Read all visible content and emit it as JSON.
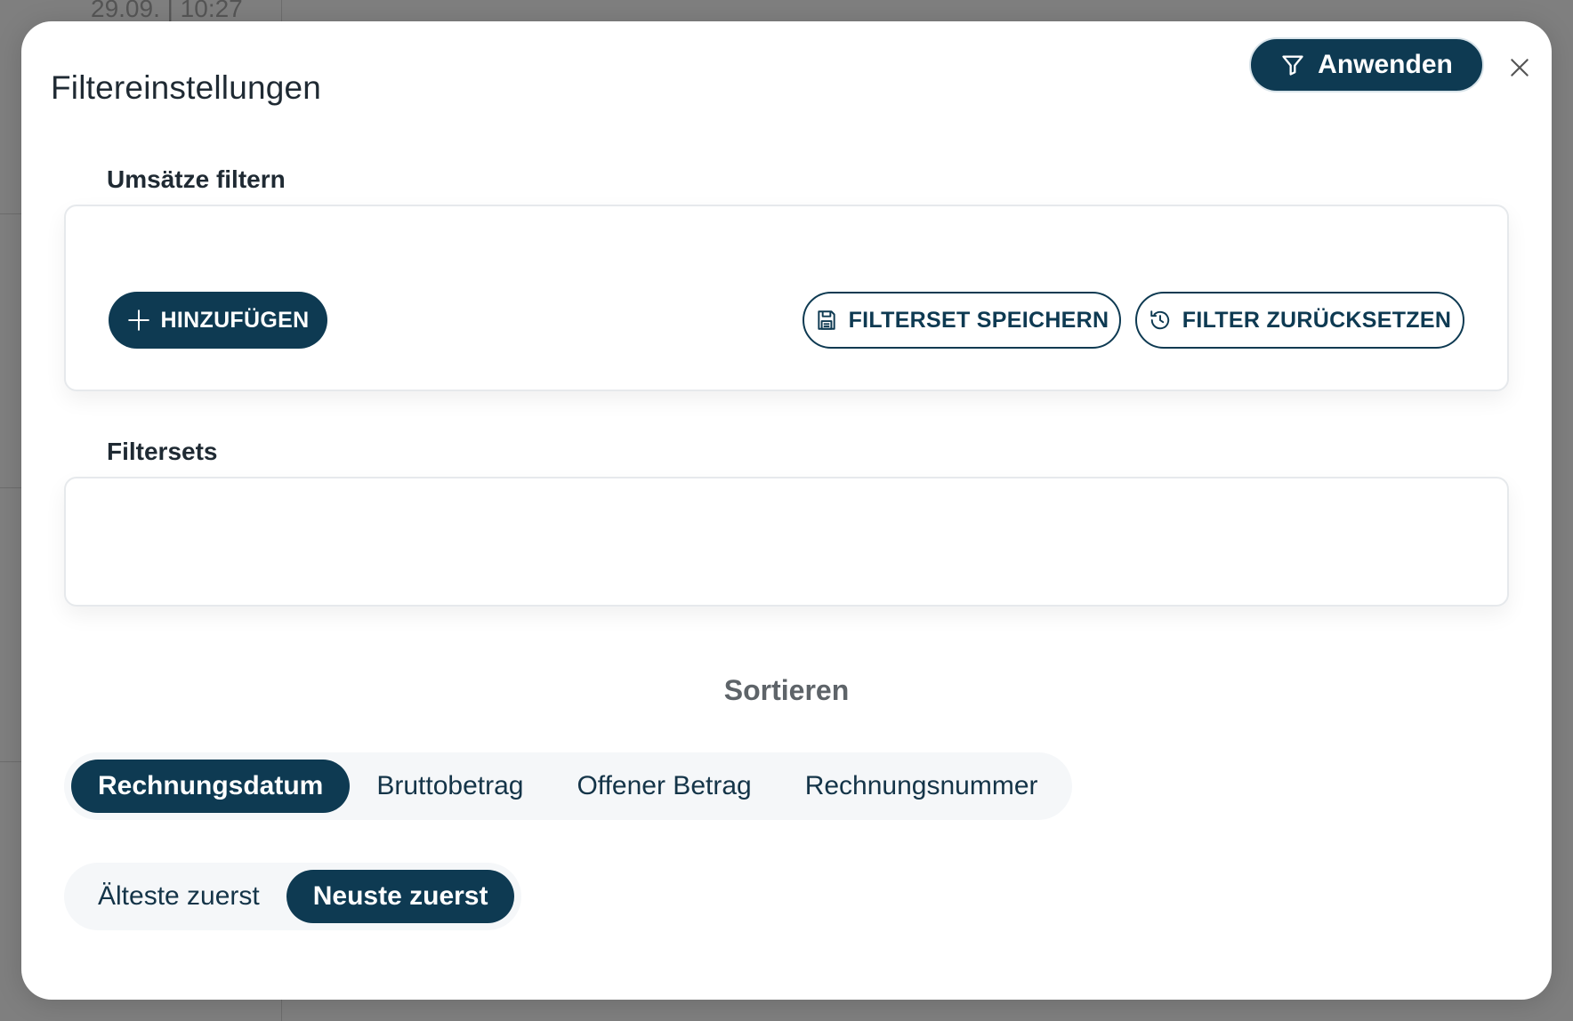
{
  "background": {
    "timestamp": "29.09. | 10:27"
  },
  "modal": {
    "title": "Filtereinstellungen",
    "apply_label": "Anwenden"
  },
  "filter_section": {
    "label": "Umsätze filtern",
    "add_label": "HINZUFÜGEN",
    "save_set_label": "FILTERSET SPEICHERN",
    "reset_label": "FILTER ZURÜCKSETZEN"
  },
  "filtersets_section": {
    "label": "Filtersets"
  },
  "sort": {
    "title": "Sortieren",
    "fields": [
      {
        "label": "Rechnungsdatum",
        "active": true
      },
      {
        "label": "Bruttobetrag",
        "active": false
      },
      {
        "label": "Offener Betrag",
        "active": false
      },
      {
        "label": "Rechnungsnummer",
        "active": false
      }
    ],
    "order": [
      {
        "label": "Älteste zuerst",
        "active": false
      },
      {
        "label": "Neuste zuerst",
        "active": true
      }
    ]
  },
  "colors": {
    "primary": "#0e3a52",
    "backdrop": "#7f7f7f",
    "surface": "#ffffff",
    "segment_bg": "#f5f7f9"
  }
}
